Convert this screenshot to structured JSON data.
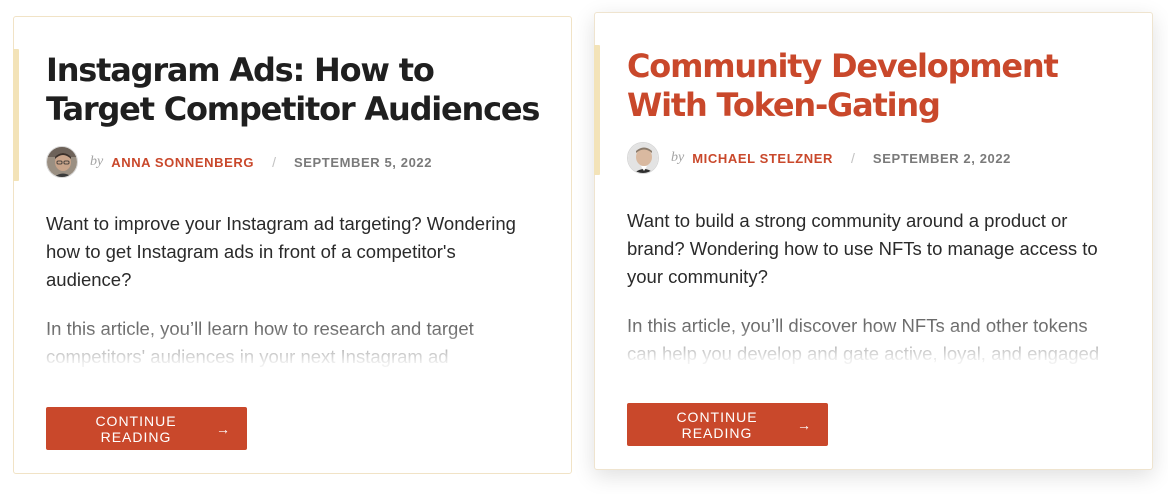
{
  "colors": {
    "accent": "#c9482b",
    "card_border": "#f1e3c6",
    "accent_bar": "#f3e3b8",
    "title_dark": "#1f1f1f"
  },
  "posts": [
    {
      "title": "Instagram Ads: How to Target Competitor Audiences",
      "by": "by",
      "author": "ANNA SONNENBERG",
      "separator": "/",
      "date": "SEPTEMBER 5, 2022",
      "excerpt_1": "Want to improve your Instagram ad targeting? Wondering how to get Instagram ads in front of a competitor's audience?",
      "excerpt_2": "In this article, you’ll learn how to research and target competitors' audiences in your next Instagram ad campaign.",
      "button_label": "CONTINUE READING",
      "button_icon": "arrow-right-icon",
      "button_arrow": "→"
    },
    {
      "title": "Community Development With Token-Gating",
      "by": "by",
      "author": "MICHAEL STELZNER",
      "separator": "/",
      "date": "SEPTEMBER 2, 2022",
      "excerpt_1": "Want to build a strong community around a product or brand? Wondering how to use NFTs to manage access to your community?",
      "excerpt_2": "In this article, you’ll discover how NFTs and other tokens can help you develop and gate active, loyal, and engaged communities.",
      "button_label": "CONTINUE READING",
      "button_icon": "arrow-right-icon",
      "button_arrow": "→"
    }
  ]
}
